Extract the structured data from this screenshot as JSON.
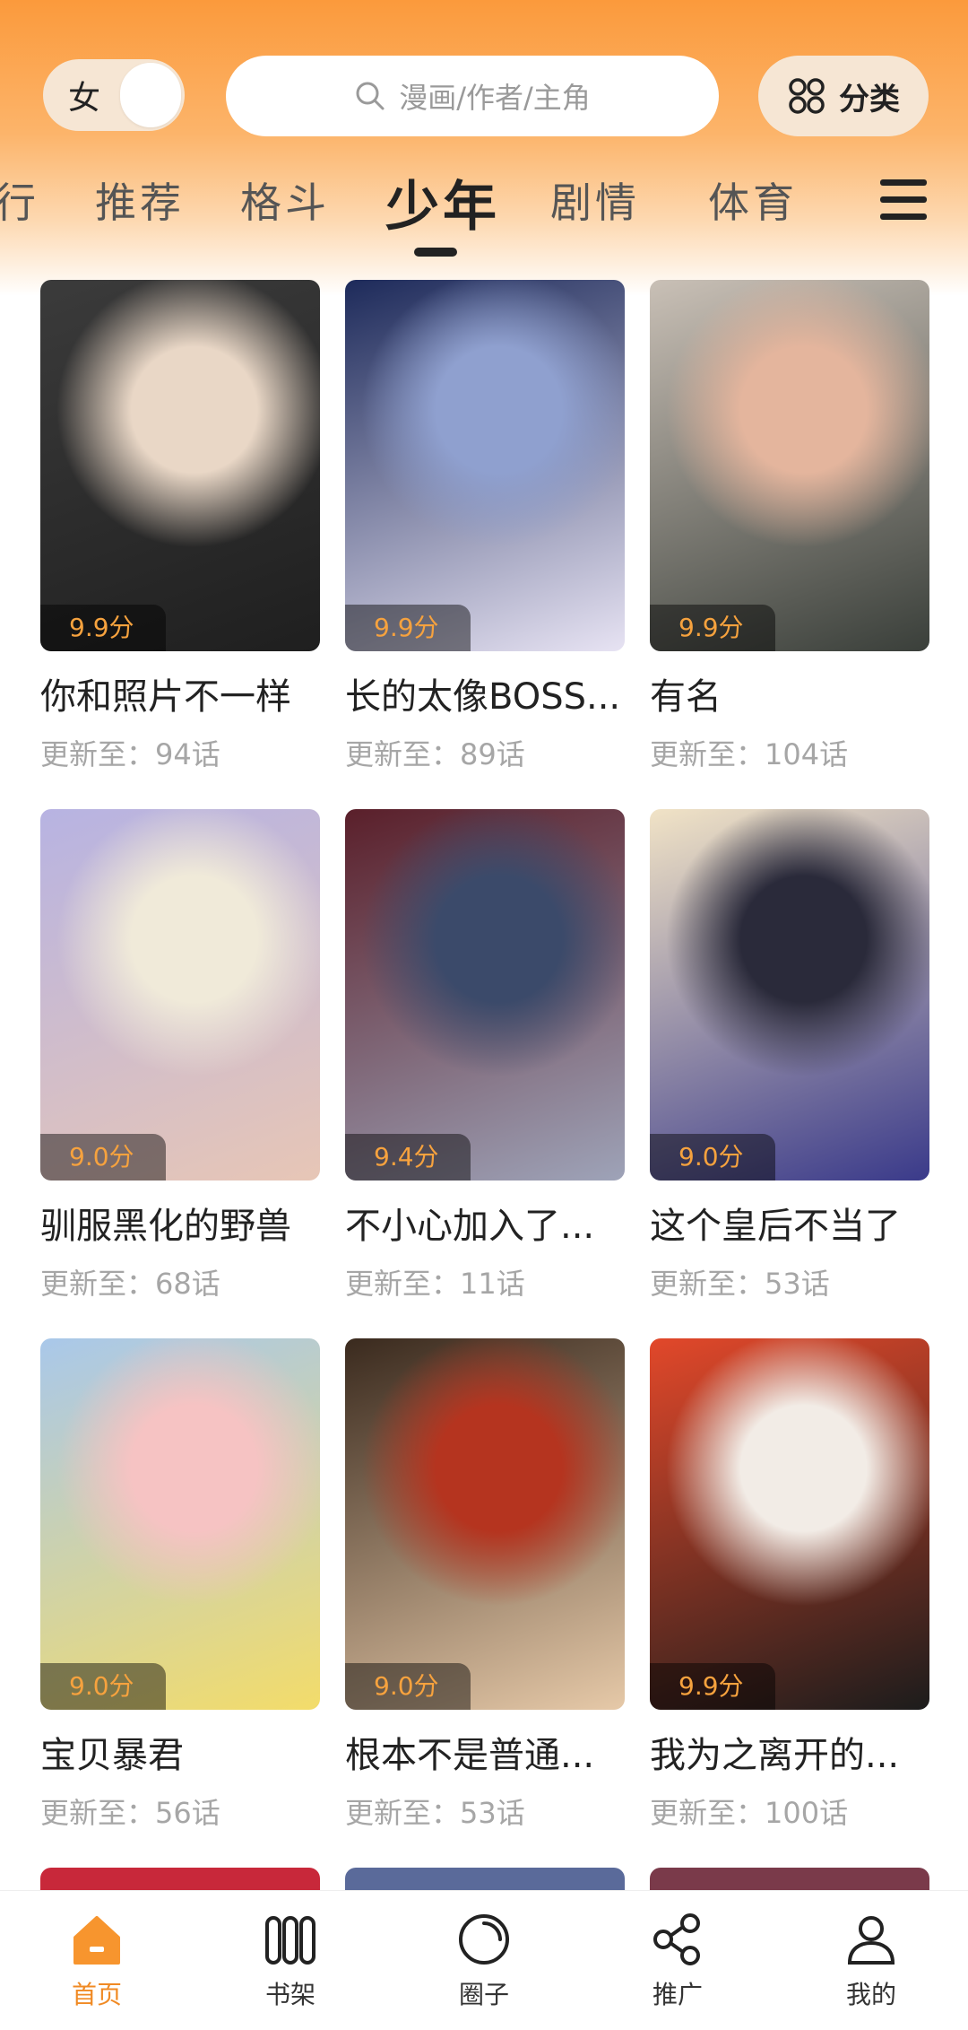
{
  "header": {
    "gender_label": "女",
    "search_placeholder": "漫画/作者/主角",
    "category_label": "分类"
  },
  "tabs": [
    {
      "label": "行",
      "active": false
    },
    {
      "label": "推荐",
      "active": false
    },
    {
      "label": "格斗",
      "active": false
    },
    {
      "label": "少年",
      "active": true
    },
    {
      "label": "剧情",
      "active": false
    },
    {
      "label": "体育",
      "active": false
    }
  ],
  "menu_icon": "hamburger-menu-icon",
  "comics": [
    {
      "score": "9.9分",
      "title": "你和照片不一样",
      "update": "更新至：94话",
      "colors": [
        "#3b3b3b",
        "#e9d7c6",
        "#1f1f1f"
      ]
    },
    {
      "score": "9.9分",
      "title": "长的太像BOSS...",
      "update": "更新至：89话",
      "colors": [
        "#1d2a5a",
        "#8fa0cf",
        "#e7e3f3"
      ]
    },
    {
      "score": "9.9分",
      "title": "有名",
      "update": "更新至：104话",
      "colors": [
        "#c9c0b6",
        "#e4b59d",
        "#3a3f3a"
      ]
    },
    {
      "score": "9.0分",
      "title": "驯服黑化的野兽",
      "update": "更新至：68话",
      "colors": [
        "#b7b3e2",
        "#f0ead9",
        "#e7c6b6"
      ]
    },
    {
      "score": "9.4分",
      "title": "不小心加入了...",
      "update": "更新至：11话",
      "colors": [
        "#5a1f2a",
        "#3b4a6a",
        "#9ea3b8"
      ]
    },
    {
      "score": "9.0分",
      "title": "这个皇后不当了",
      "update": "更新至：53话",
      "colors": [
        "#f1e3c6",
        "#2a2a3a",
        "#3a3a8a"
      ]
    },
    {
      "score": "9.0分",
      "title": "宝贝暴君",
      "update": "更新至：56话",
      "colors": [
        "#a9c8ea",
        "#f6c3c3",
        "#f3dc6a"
      ]
    },
    {
      "score": "9.0分",
      "title": "根本不是普通...",
      "update": "更新至：53话",
      "colors": [
        "#3a2a1e",
        "#b5341f",
        "#e6c9a8"
      ]
    },
    {
      "score": "9.9分",
      "title": "我为之离开的...",
      "update": "更新至：100话",
      "colors": [
        "#e2482a",
        "#f2ece6",
        "#1c1c1c"
      ]
    }
  ],
  "bottom_nav": [
    {
      "label": "首页",
      "icon": "home-icon",
      "active": true
    },
    {
      "label": "书架",
      "icon": "bookshelf-icon",
      "active": false
    },
    {
      "label": "圈子",
      "icon": "circle-icon",
      "active": false
    },
    {
      "label": "推广",
      "icon": "share-icon",
      "active": false
    },
    {
      "label": "我的",
      "icon": "profile-icon",
      "active": false
    }
  ],
  "colors": {
    "accent": "#f08a24",
    "score": "#f6a23e",
    "header_top": "#fb9a3c"
  }
}
